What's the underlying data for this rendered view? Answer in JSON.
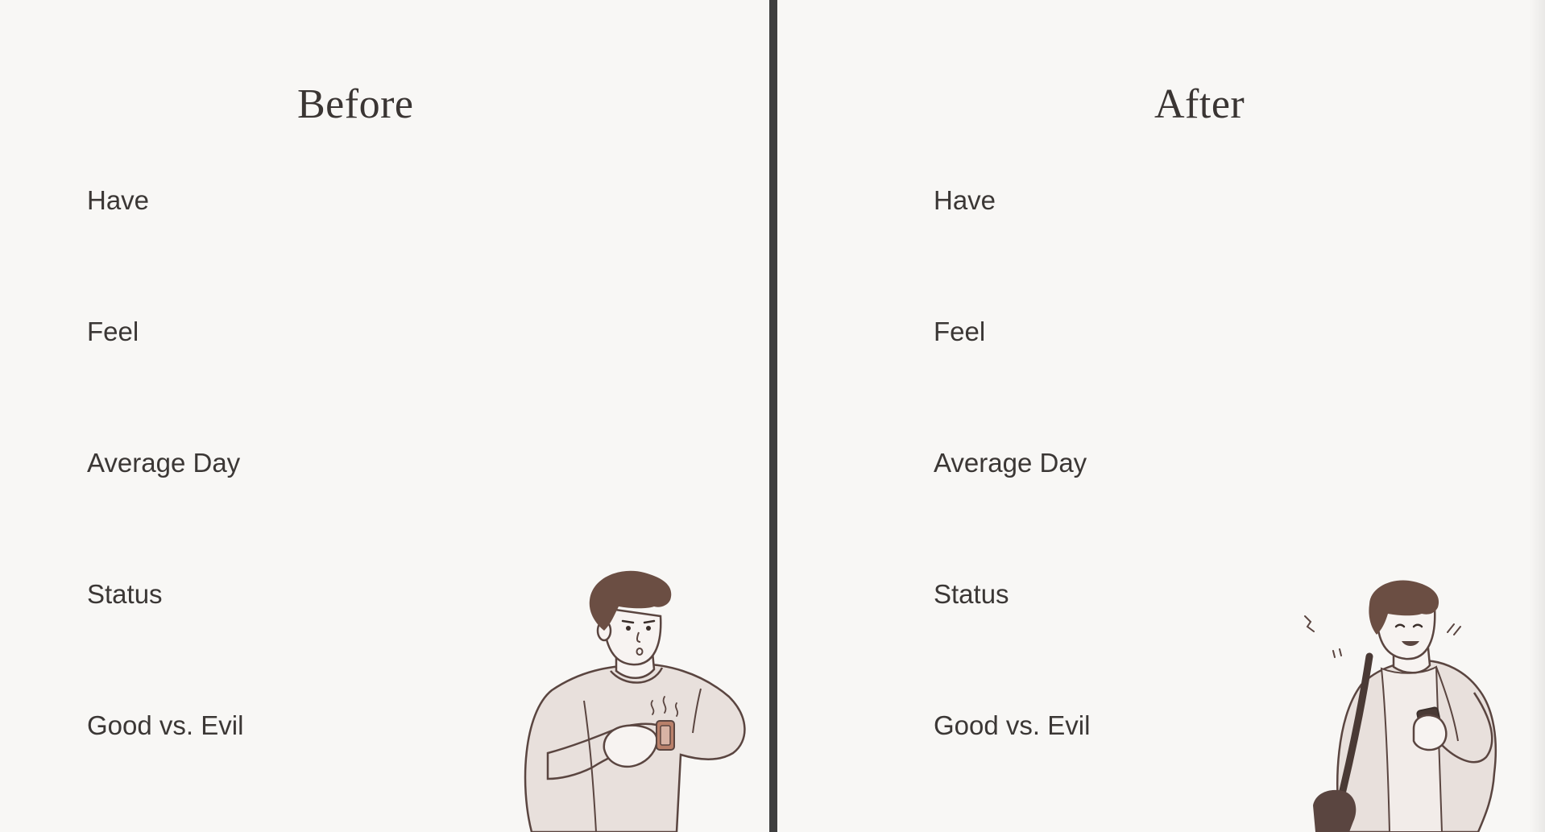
{
  "before": {
    "title": "Before",
    "rows": [
      "Have",
      "Feel",
      "Average Day",
      "Status",
      "Good vs. Evil"
    ]
  },
  "after": {
    "title": "After",
    "rows": [
      "Have",
      "Feel",
      "Average Day",
      "Status",
      "Good vs. Evil"
    ]
  },
  "colors": {
    "background": "#f8f7f5",
    "divider": "#3f3f3f",
    "text": "#3b3735",
    "hair": "#6b4e43",
    "shirt": "#e8e0dc",
    "outline": "#5a4540",
    "accent": "#b9806a"
  }
}
